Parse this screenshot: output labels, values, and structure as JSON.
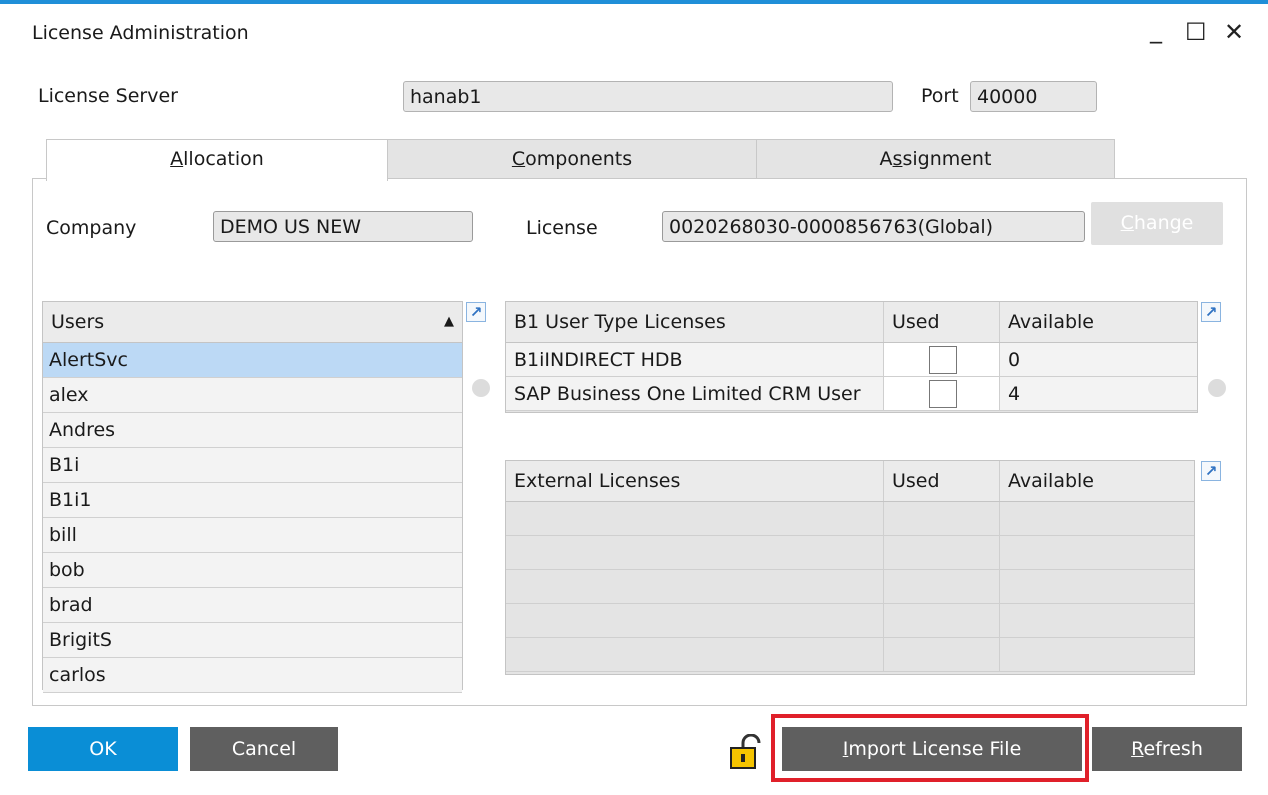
{
  "window": {
    "title": "License Administration",
    "controls": {
      "minimize": "_",
      "maximize": "☐",
      "close": "✕"
    }
  },
  "server": {
    "label": "License Server",
    "value": "hanab1",
    "port_label": "Port",
    "port_value": "40000"
  },
  "tabs": [
    {
      "pre": "",
      "u": "A",
      "post": "llocation"
    },
    {
      "pre": "",
      "u": "C",
      "post": "omponents"
    },
    {
      "pre": "A",
      "u": "s",
      "post": "signment"
    }
  ],
  "allocation": {
    "company_label": "Company",
    "company_value": "DEMO US NEW",
    "license_label": "License",
    "license_value": "0020268030-0000856763(Global)",
    "change_button": {
      "u": "C",
      "post": "hange"
    }
  },
  "users": {
    "header": "Users",
    "sort_indicator": "▲",
    "items": [
      "AlertSvc",
      "alex",
      "Andres",
      "B1i",
      "B1i1",
      "bill",
      "bob",
      "brad",
      "BrigitS",
      "carlos"
    ]
  },
  "b1_licenses": {
    "headers": [
      "B1 User Type Licenses",
      "Used",
      "Available"
    ],
    "rows": [
      {
        "name": "B1iINDIRECT HDB",
        "available": "0"
      },
      {
        "name": "SAP Business One Limited CRM User",
        "available": "4"
      }
    ]
  },
  "external_licenses": {
    "headers": [
      "External Licenses",
      "Used",
      "Available"
    ]
  },
  "icons": {
    "expand": "↗",
    "lock": "lock-icon"
  },
  "buttons": {
    "ok": "OK",
    "cancel": "Cancel",
    "import": {
      "u": "I",
      "post": "mport License File"
    },
    "refresh": {
      "u": "R",
      "post": "efresh"
    }
  },
  "colors": {
    "accent": "#0a8ed6",
    "button_gray": "#5f5f5f",
    "highlight": "#e0202a",
    "selected_row": "#bcd9f5"
  }
}
